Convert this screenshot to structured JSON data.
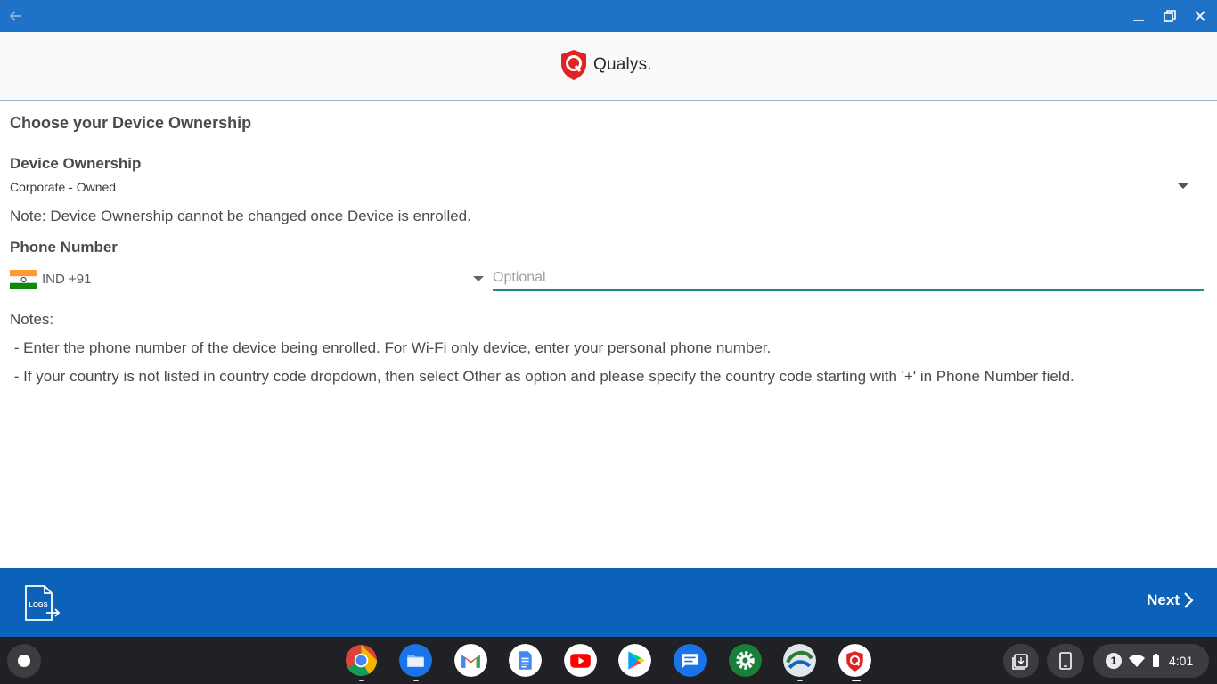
{
  "titlebar": {
    "back_icon": "back-arrow-icon",
    "minimize_icon": "minimize-icon",
    "restore_icon": "restore-icon",
    "close_icon": "close-icon",
    "color": "#1e73c9"
  },
  "header": {
    "logo_text": "Qualys.",
    "brand_color": "#e02424"
  },
  "page": {
    "heading": "Choose your Device Ownership",
    "ownership_label": "Device Ownership",
    "ownership_value": "Corporate - Owned",
    "ownership_note": "Note: Device Ownership cannot be changed once Device is enrolled.",
    "phone_label": "Phone Number",
    "country_code": "IND +91",
    "phone_placeholder": "Optional",
    "notes_title": "Notes:",
    "notes": [
      " - Enter the phone number of the device being enrolled. For Wi-Fi only device, enter your personal phone number.",
      " - If your country is not listed in country code dropdown, then select Other as option and please specify the country code starting with '+' in Phone Number field."
    ]
  },
  "footer": {
    "logs_label": "LOGS",
    "next_label": "Next",
    "color": "#0b62b8"
  },
  "shelf": {
    "apps": [
      "chrome-icon",
      "files-icon",
      "gmail-icon",
      "docs-icon",
      "youtube-icon",
      "play-store-icon",
      "messages-icon",
      "settings-icon",
      "app-icon",
      "qualys-icon"
    ],
    "notification_count": "1",
    "time": "4:01"
  }
}
